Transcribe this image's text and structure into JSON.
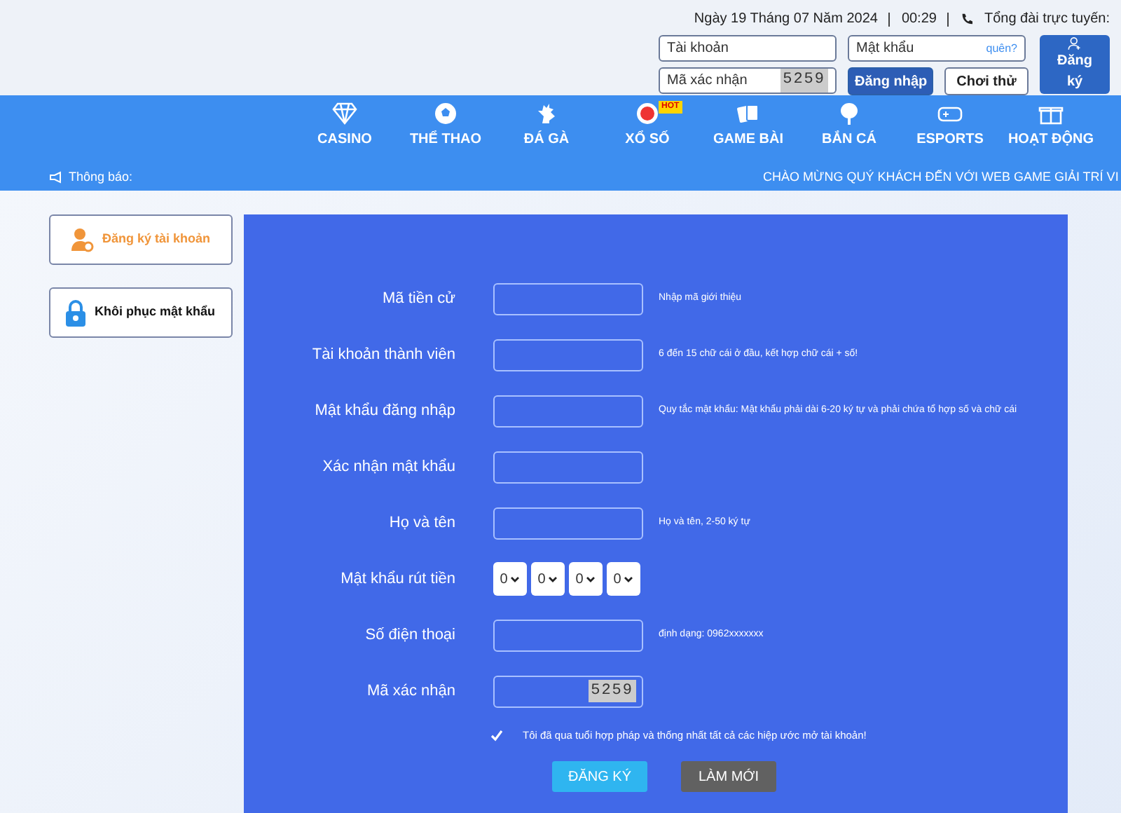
{
  "header": {
    "date": "Ngày 19 Tháng 07 Năm 2024",
    "time": "00:29",
    "hotline": "Tổng đài trực tuyến:"
  },
  "login": {
    "account_placeholder": "Tài khoản",
    "password_placeholder": "Mật khẩu",
    "forgot": "quên?",
    "captcha_placeholder": "Mã xác nhận",
    "captcha_code": "5259",
    "login_button": "Đăng nhập",
    "trial_button": "Chơi thử",
    "register_button": "Đăng ký"
  },
  "nav": [
    {
      "label": "CASINO"
    },
    {
      "label": "THỂ THAO"
    },
    {
      "label": "ĐÁ GÀ"
    },
    {
      "label": "XỔ SỐ",
      "badge": "HOT"
    },
    {
      "label": "GAME BÀI"
    },
    {
      "label": "BẮN CÁ"
    },
    {
      "label": "ESPORTS"
    },
    {
      "label": "HOẠT ĐỘNG"
    }
  ],
  "notice": {
    "label": "Thông báo:",
    "text": "CHÀO MỪNG QUÝ KHÁCH ĐẾN VỚI WEB GAME GIẢI TRÍ VI"
  },
  "sidebar": [
    {
      "label": "Đăng ký tài khoản",
      "kind": "register"
    },
    {
      "label": "Khôi phục mật khẩu",
      "kind": "recover"
    }
  ],
  "form": {
    "rows": [
      {
        "label": "Mã tiền cử",
        "kind": "input",
        "hint": "Nhập mã giới thiệu"
      },
      {
        "label": "Tài khoản thành viên",
        "kind": "input",
        "hint": "6 đến 15 chữ cái ở đầu, kết hợp chữ cái + số!"
      },
      {
        "label": "Mật khẩu đăng nhập",
        "kind": "input",
        "hint": "Quy tắc mật khẩu: Mật khẩu phải dài 6-20 ký tự và phải chứa tổ hợp số và chữ cái"
      },
      {
        "label": "Xác nhận mật khẩu",
        "kind": "input"
      },
      {
        "label": "Họ và tên",
        "kind": "input",
        "hint": "Họ và tên, 2-50 ký tự"
      },
      {
        "label": "Mật khẩu rút tiền",
        "kind": "pin",
        "digits": [
          "0",
          "0",
          "0",
          "0"
        ]
      },
      {
        "label": "Số điện thoại",
        "kind": "input",
        "hint": "định dạng: 0962xxxxxxx"
      },
      {
        "label": "Mã xác nhận",
        "kind": "captcha",
        "code": "5259"
      }
    ],
    "agree": {
      "text": "Tôi đã qua tuổi hợp pháp và thống nhất tất cả các hiệp ước mở tài khoản!",
      "checked": true
    },
    "submit": "ĐĂNG KÝ",
    "reset": "LÀM MỚI"
  }
}
